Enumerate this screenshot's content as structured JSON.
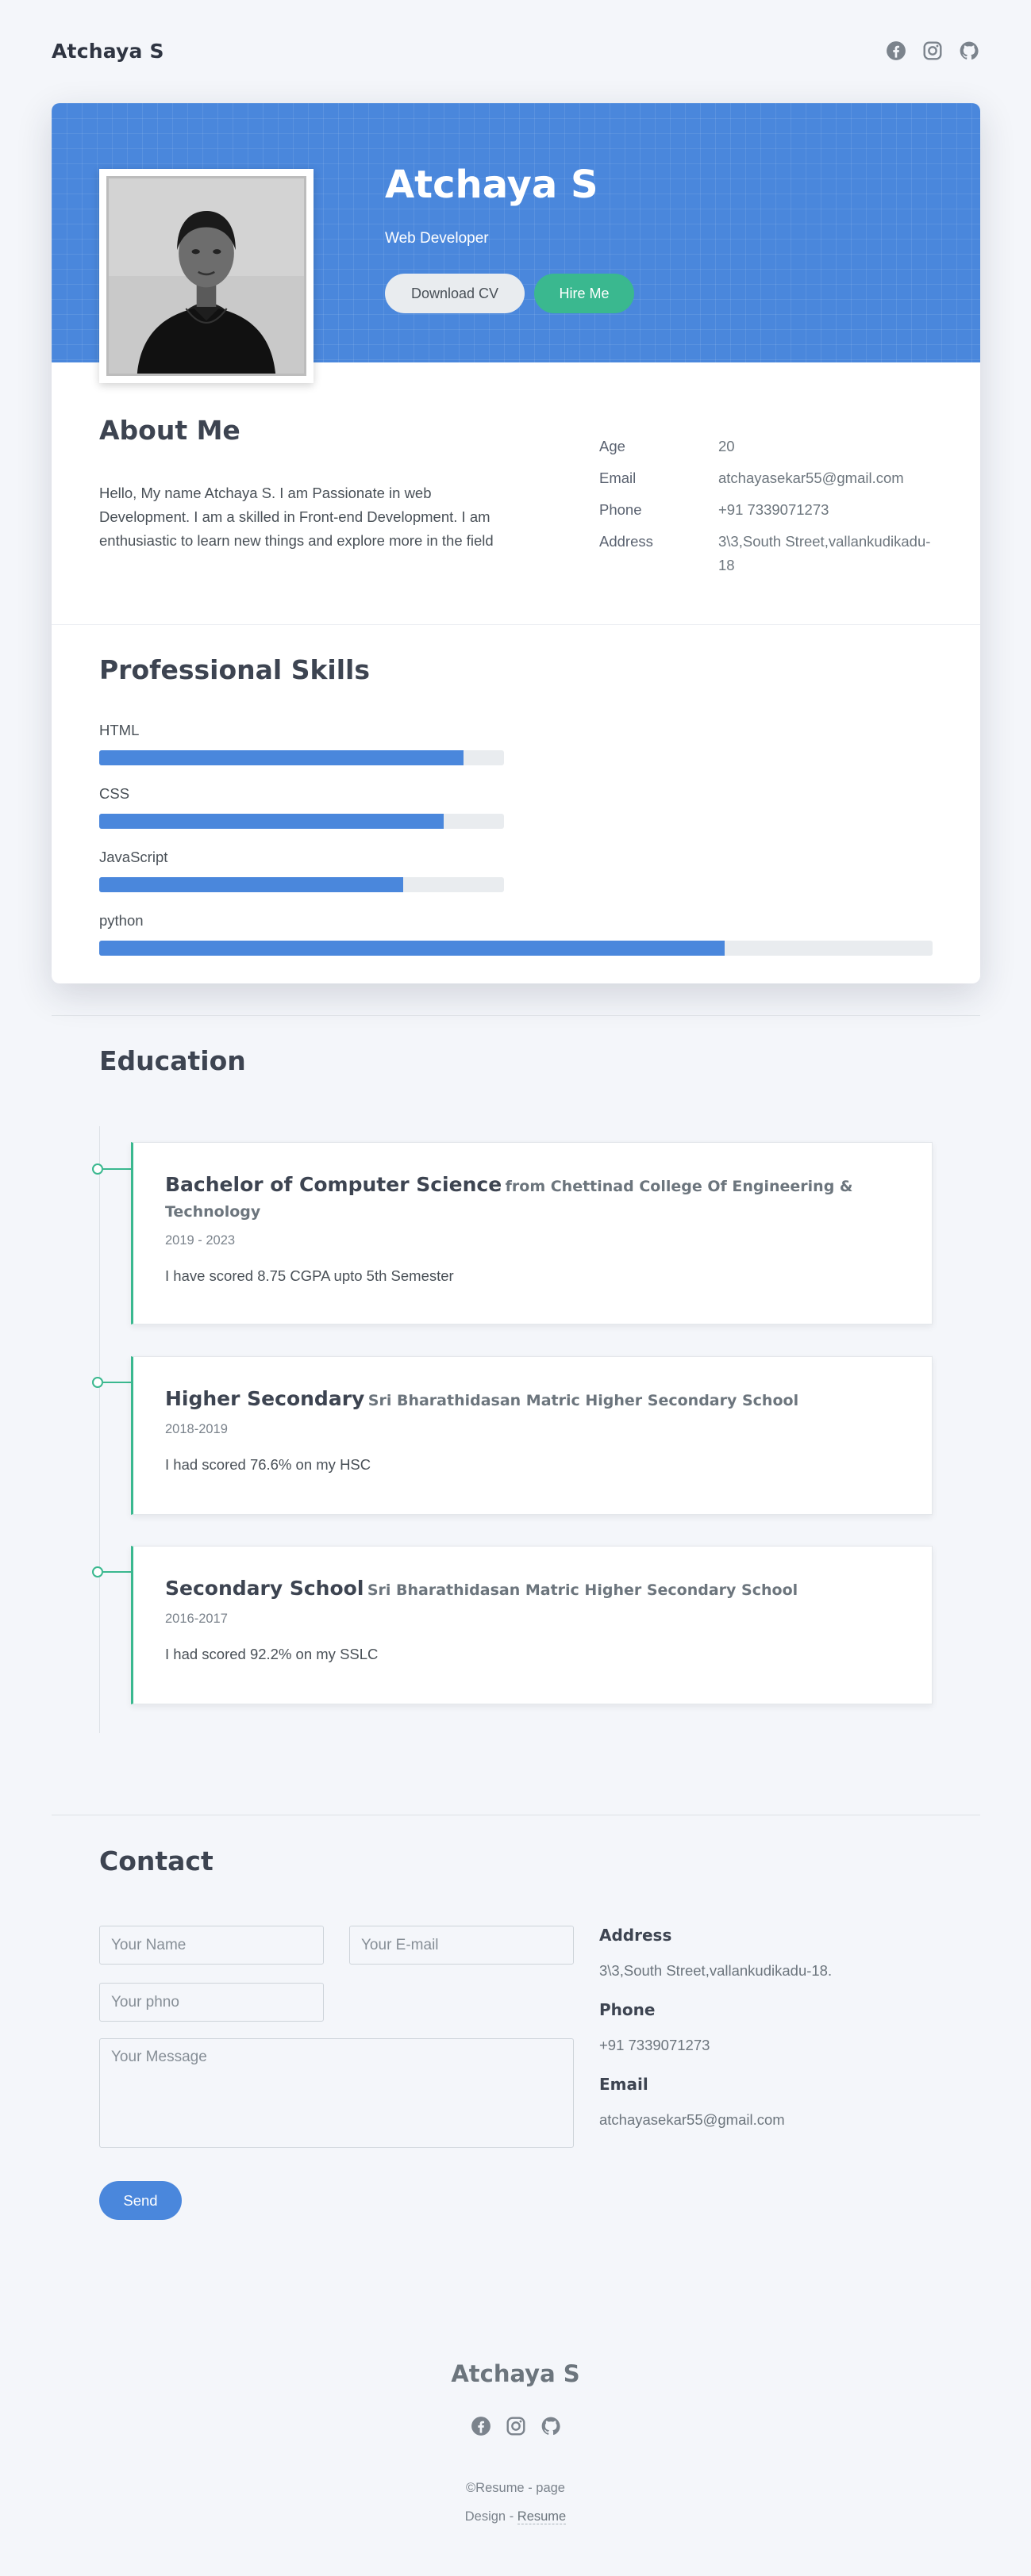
{
  "header": {
    "brand": "Atchaya S",
    "social": [
      "facebook-icon",
      "instagram-icon",
      "github-icon"
    ]
  },
  "hero": {
    "name": "Atchaya S",
    "role": "Web Developer",
    "download_label": "Download CV",
    "hire_label": "Hire Me"
  },
  "about": {
    "title": "About Me",
    "text": "Hello, My name Atchaya S. I am Passionate in web Development. I am a skilled in Front-end Development. I am enthusiastic to learn new things and explore more in the field",
    "info": [
      {
        "key": "Age",
        "value": "20"
      },
      {
        "key": "Email",
        "value": "atchayasekar55@gmail.com"
      },
      {
        "key": "Phone",
        "value": "+91 7339071273"
      },
      {
        "key": "Address",
        "value": "3\\3,South Street,vallankudikadu-18"
      }
    ]
  },
  "skills": {
    "title": "Professional Skills",
    "items": [
      {
        "name": "HTML",
        "percent": 90
      },
      {
        "name": "CSS",
        "percent": 85
      },
      {
        "name": "JavaScript",
        "percent": 75
      },
      {
        "name": "python",
        "percent": 75
      }
    ]
  },
  "education": {
    "title": "Education",
    "items": [
      {
        "degree": "Bachelor of Computer Science",
        "school": "from Chettinad College Of Engineering & Technology",
        "years": "2019 - 2023",
        "desc": "I have scored 8.75 CGPA upto 5th Semester"
      },
      {
        "degree": "Higher Secondary",
        "school": "Sri Bharathidasan Matric Higher Secondary School",
        "years": "2018-2019",
        "desc": "I had scored 76.6% on my HSC"
      },
      {
        "degree": "Secondary School",
        "school": "Sri Bharathidasan Matric Higher Secondary School",
        "years": "2016-2017",
        "desc": "I had scored 92.2% on my SSLC"
      }
    ]
  },
  "contact": {
    "title": "Contact",
    "name_placeholder": "Your Name",
    "email_placeholder": "Your E-mail",
    "phone_placeholder": "Your phno",
    "message_placeholder": "Your Message",
    "send_label": "Send",
    "address_label": "Address",
    "address_value": "3\\3,South Street,vallankudikadu-18.",
    "phone_label": "Phone",
    "phone_value": "+91 7339071273",
    "email_label": "Email",
    "email_value": "atchayasekar55@gmail.com"
  },
  "footer": {
    "brand": "Atchaya S",
    "copyright": "©Resume - page",
    "design_prefix": "Design - ",
    "design_link": "Resume"
  },
  "colors": {
    "primary": "#4a87dc",
    "accent_green": "#3ab88f",
    "background": "#f4f6fa",
    "heading": "#3d4451"
  }
}
